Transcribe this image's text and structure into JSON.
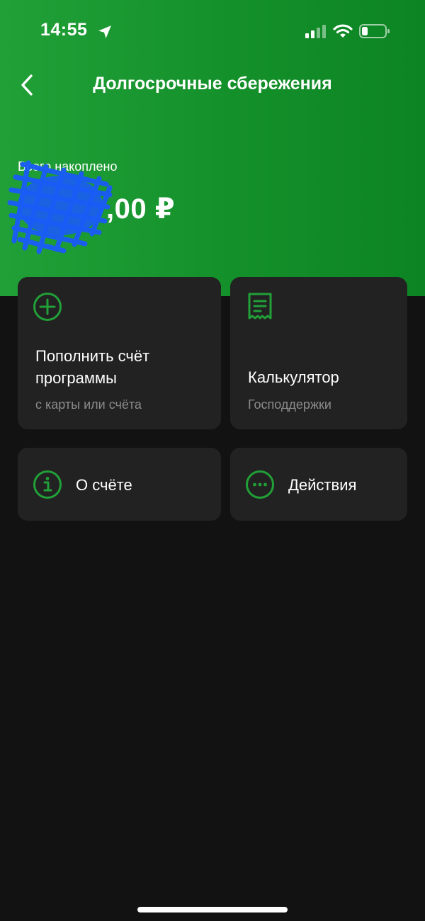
{
  "status_bar": {
    "time": "14:55",
    "icons": [
      "location-arrow-icon",
      "cellular-signal-icon",
      "wifi-icon",
      "battery-icon"
    ]
  },
  "header": {
    "back_icon": "chevron-left-icon",
    "title": "Долгосрочные сбережения"
  },
  "balance": {
    "label": "Всего накоплено",
    "amount_visible": ",00 ₽"
  },
  "cards": {
    "topup": {
      "icon": "plus-circle-icon",
      "title_line1": "Пополнить счёт",
      "title_line2": "программы",
      "subtitle": "с карты или счёта"
    },
    "calculator": {
      "icon": "receipt-icon",
      "title": "Калькулятор",
      "subtitle": "Господдержки"
    },
    "about": {
      "icon": "info-circle-icon",
      "title": "О счёте"
    },
    "actions": {
      "icon": "more-dots-circle-icon",
      "title": "Действия"
    }
  },
  "colors": {
    "brand_green": "#21a038",
    "icon_green": "#21a038",
    "card_bg": "#222222",
    "page_bg": "#121212",
    "subtitle_gray": "#8b8b8b"
  }
}
